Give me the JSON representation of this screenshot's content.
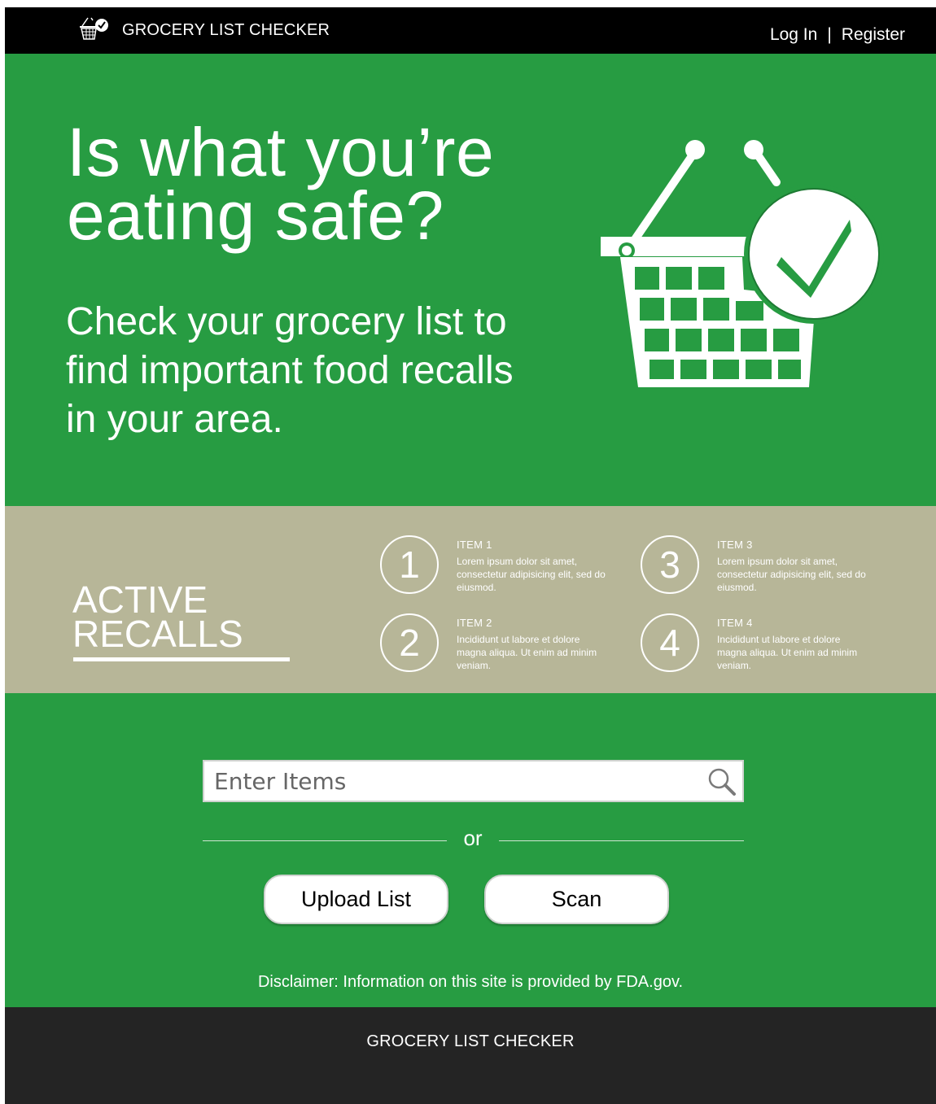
{
  "nav": {
    "brand_name": "GROCERY LIST CHECKER",
    "brand_icon": "shopping-basket-check-icon",
    "login_label": "Log In",
    "separator": "|",
    "register_label": "Register"
  },
  "hero": {
    "headline_line1": "Is what you’re",
    "headline_line2": "eating safe?",
    "subhead_line1": "Check your grocery list to",
    "subhead_line2": "find important food recalls",
    "subhead_line3": "in your area.",
    "illustration_icon": "basket-checkmark-icon"
  },
  "recalls": {
    "title_line1": "ACTIVE",
    "title_line2": "RECALLS",
    "items": [
      {
        "number": "1",
        "title": "ITEM 1",
        "description": "Lorem ipsum dolor sit amet, consectetur adipisicing elit, sed do eiusmod."
      },
      {
        "number": "2",
        "title": "ITEM 2",
        "description": "Incididunt ut labore et dolore magna aliqua. Ut enim ad minim veniam."
      },
      {
        "number": "3",
        "title": "ITEM 3",
        "description": "Lorem ipsum dolor sit amet, consectetur adipisicing elit, sed do eiusmod."
      },
      {
        "number": "4",
        "title": "ITEM 4",
        "description": "Incididunt ut labore et dolore magna aliqua. Ut enim ad minim veniam."
      }
    ]
  },
  "search": {
    "placeholder": "Enter Items",
    "value": "",
    "icon": "search-icon",
    "or_label": "or",
    "upload_label": "Upload List",
    "scan_label": "Scan"
  },
  "disclaimer": "Disclaimer: Information on this site is provided by FDA.gov.",
  "footer": {
    "brand_name": "GROCERY LIST CHECKER"
  },
  "colors": {
    "green": "#279c42",
    "tan": "#b7b698",
    "topbar": "#000000",
    "footer": "#242424"
  }
}
